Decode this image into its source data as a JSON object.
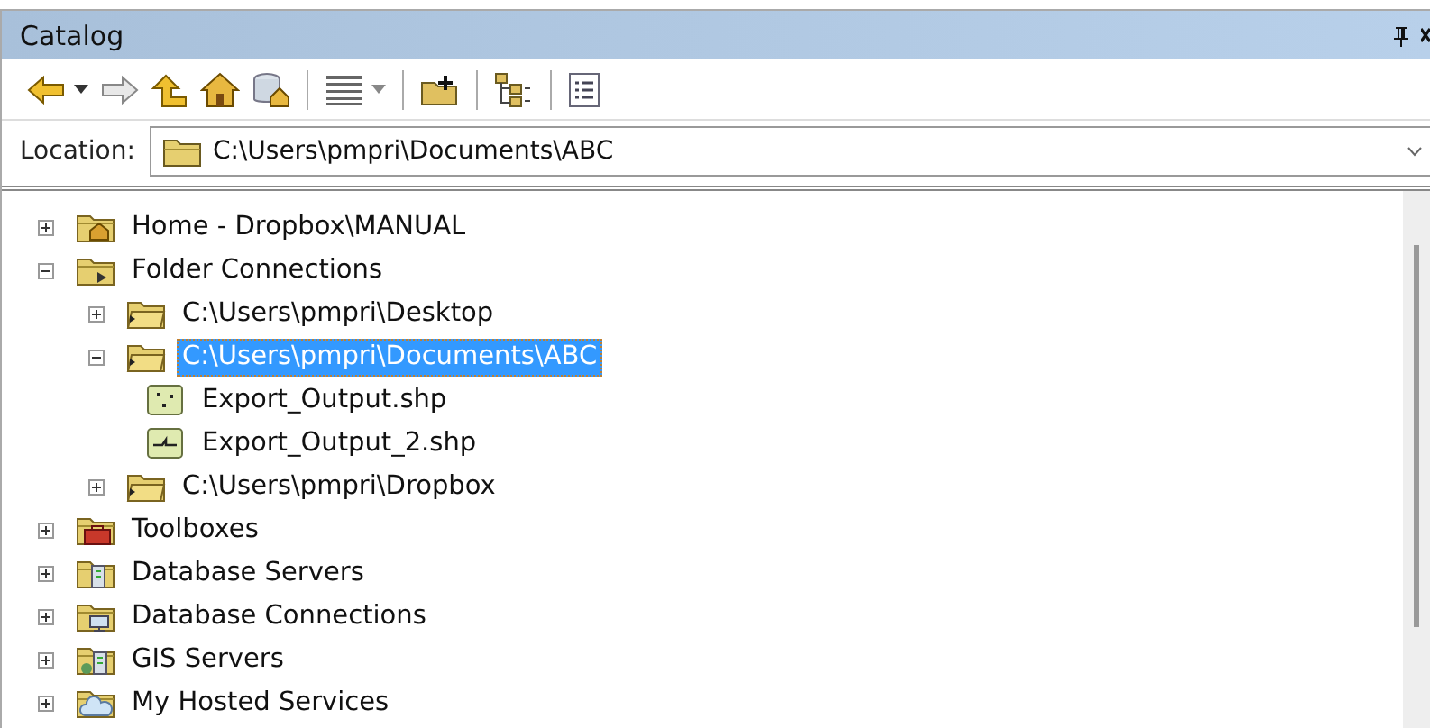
{
  "window": {
    "title": "Catalog"
  },
  "location": {
    "label": "Location:",
    "value": "C:\\Users\\pmpri\\Documents\\ABC"
  },
  "tree": [
    {
      "label": "Home - Dropbox\\MANUAL",
      "kind": "home",
      "expanded": false,
      "selected": false
    },
    {
      "label": "Folder Connections",
      "kind": "connections",
      "expanded": true,
      "selected": false,
      "children": [
        {
          "label": "C:\\Users\\pmpri\\Desktop",
          "kind": "folder",
          "expanded": false,
          "selected": false
        },
        {
          "label": "C:\\Users\\pmpri\\Documents\\ABC",
          "kind": "folder",
          "expanded": true,
          "selected": true,
          "children": [
            {
              "label": "Export_Output.shp",
              "kind": "points",
              "selected": false
            },
            {
              "label": "Export_Output_2.shp",
              "kind": "lines",
              "selected": false
            }
          ]
        },
        {
          "label": "C:\\Users\\pmpri\\Dropbox",
          "kind": "folder",
          "expanded": false,
          "selected": false
        }
      ]
    },
    {
      "label": "Toolboxes",
      "kind": "toolbox",
      "expanded": false,
      "selected": false
    },
    {
      "label": "Database Servers",
      "kind": "dbserver",
      "expanded": false,
      "selected": false
    },
    {
      "label": "Database Connections",
      "kind": "dbconnection",
      "expanded": false,
      "selected": false
    },
    {
      "label": "GIS Servers",
      "kind": "gisserver",
      "expanded": false,
      "selected": false
    },
    {
      "label": "My Hosted Services",
      "kind": "hosted",
      "expanded": false,
      "selected": false
    }
  ]
}
